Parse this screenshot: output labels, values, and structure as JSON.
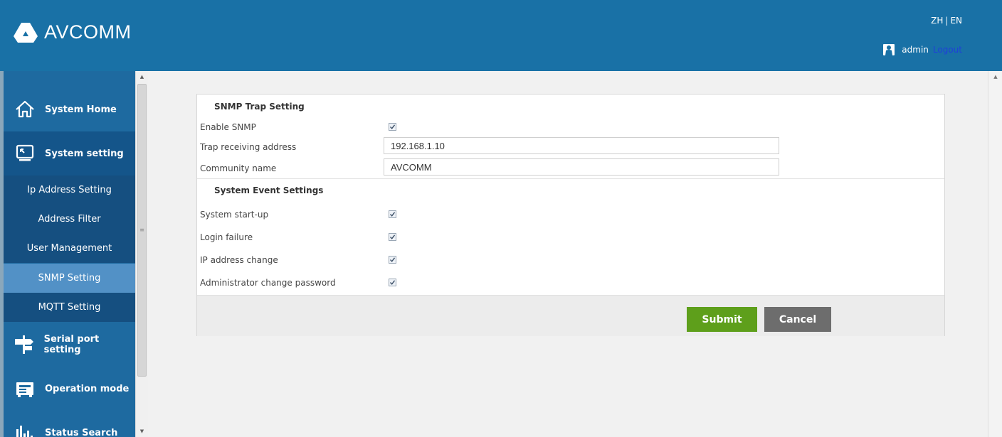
{
  "brand": {
    "name": "AVCOMM"
  },
  "header": {
    "lang_zh": "ZH",
    "lang_sep": "|",
    "lang_en": "EN",
    "username": "admin",
    "logout": "Logout"
  },
  "sidebar": {
    "items": [
      {
        "label": "System Home",
        "icon": "home-icon"
      },
      {
        "label": "System setting",
        "icon": "monitor-icon"
      },
      {
        "label": "Serial port setting",
        "icon": "signpost-icon"
      },
      {
        "label": "Operation mode",
        "icon": "device-icon"
      },
      {
        "label": "Status Search",
        "icon": "bar-chart-icon"
      }
    ],
    "subitems": [
      {
        "label": "Ip Address Setting"
      },
      {
        "label": "Address Filter"
      },
      {
        "label": "User Management"
      },
      {
        "label": "SNMP Setting"
      },
      {
        "label": "MQTT Setting"
      }
    ],
    "selected": "SNMP Setting"
  },
  "form": {
    "trap_title": "SNMP Trap Setting",
    "enable_snmp": {
      "label": "Enable SNMP",
      "checked": true
    },
    "trap_address": {
      "label": "Trap receiving address",
      "value": "192.168.1.10"
    },
    "community": {
      "label": "Community name",
      "value": "AVCOMM"
    },
    "event_title": "System Event Settings",
    "events": [
      {
        "label": "System start-up",
        "checked": true
      },
      {
        "label": "Login failure",
        "checked": true
      },
      {
        "label": "IP address change",
        "checked": true
      },
      {
        "label": "Administrator change password",
        "checked": true
      }
    ],
    "submit": "Submit",
    "cancel": "Cancel"
  },
  "colors": {
    "header": "#1971a6",
    "sidebar": "#1e6aa0",
    "submenu": "#154f80",
    "selected": "#5291c6",
    "submit": "#5e9f1b",
    "cancel": "#6d6d6d",
    "logout_link": "#1f40d8"
  }
}
